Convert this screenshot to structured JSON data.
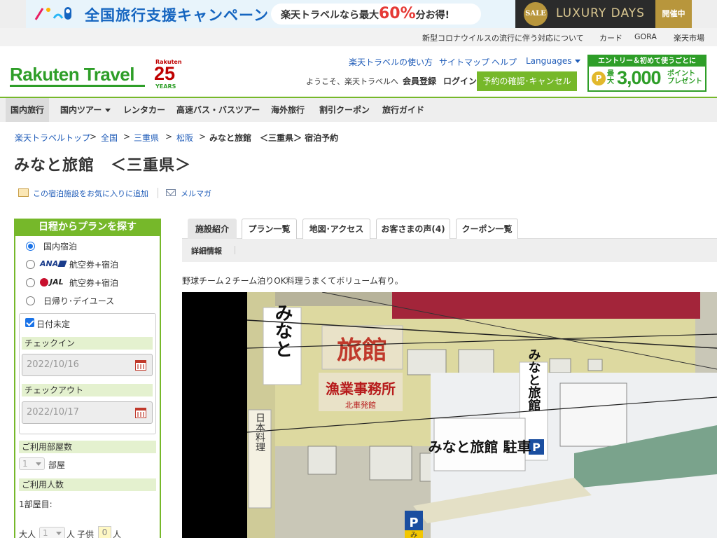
{
  "promo": {
    "title": "全国旅行支援キャンペーン",
    "pill_prefix": "楽天トラベルなら最大",
    "pill_big": "60%",
    "pill_suffix": "分お得!",
    "sale_badge": "SALE",
    "luxury": "LUXURY DAYS",
    "open": "開催中"
  },
  "util_links": [
    "新型コロナウイルスの流行に伴う対応について",
    "カード",
    "GORA",
    "楽天市場"
  ],
  "header": {
    "logo": "Rakuten Travel",
    "anniv_brand": "Rakuten",
    "anniv_number": "25",
    "anniv_years": "YEARS",
    "links": [
      "楽天トラベルの使い方",
      "サイトマップ",
      "ヘルプ"
    ],
    "languages": "Languages",
    "welcome": "ようこそ、楽天トラベルへ",
    "register": "会員登録",
    "login": "ログイン",
    "confirm_button": "予約の確認･キャンセル",
    "entry": {
      "head": "エントリー＆初めて使うごとに",
      "coin": "P",
      "small": "最大",
      "amount": "3,000",
      "unit_line1": "ポイント",
      "unit_line2": "プレゼント"
    }
  },
  "gnav": [
    "国内旅行",
    "国内ツアー",
    "レンタカー",
    "高速バス・バスツアー",
    "海外旅行",
    "割引クーポン",
    "旅行ガイド"
  ],
  "breadcrumb": {
    "links": [
      "楽天トラベルトップ",
      "全国",
      "三重県",
      "松阪"
    ],
    "separator": ">",
    "current": "みなと旅館　＜三重県＞ 宿泊予約"
  },
  "page_title": "みなと旅館　＜三重県＞",
  "actions": {
    "favorite": "この宿泊施設をお気に入りに追加",
    "mailmag": "メルマガ"
  },
  "search_panel": {
    "title": "日程からプランを探す",
    "options": [
      {
        "label": "国内宿泊",
        "selected": true
      },
      {
        "brand": "ANA",
        "label": "航空券+宿泊",
        "selected": false
      },
      {
        "brand": "JAL",
        "label": "航空券+宿泊",
        "selected": false
      },
      {
        "label": "日帰り･デイユース",
        "selected": false
      }
    ],
    "date_undecided": "日付未定",
    "checkin_label": "チェックイン",
    "checkin_value": "2022/10/16",
    "checkout_label": "チェックアウト",
    "checkout_value": "2022/10/17",
    "rooms_label": "ご利用部屋数",
    "rooms_value": "1",
    "rooms_unit": "部屋",
    "guests_label": "ご利用人数",
    "room1_label": "1部屋目:",
    "adult_label": "大人",
    "adult_value": "1",
    "adult_unit": "人",
    "child_label": "子供",
    "child_value": "0",
    "child_unit": "人"
  },
  "tabs": [
    "施設紹介",
    "プラン一覧",
    "地図･アクセス",
    "お客さまの声(4)",
    "クーポン一覧"
  ],
  "subtab": "詳細情報",
  "catch_copy": "野球チーム２チーム泊りOK料理うまくてボリューム有り。",
  "photo_signs": {
    "vertical_left": "みなと",
    "kanji": "旅館",
    "red_banner": "漁業事務所",
    "red_small": "北車発館",
    "vertical_right": "みなと旅館",
    "parking_sign": "みなと旅館 駐車",
    "narrow_sign": "日本料理",
    "p": "P",
    "p_sub": "み"
  },
  "colors": {
    "rakuten_green": "#2e9e28",
    "button_green": "#76b82a",
    "link_blue": "#1e5bb8",
    "accent_red": "#bf0000"
  }
}
